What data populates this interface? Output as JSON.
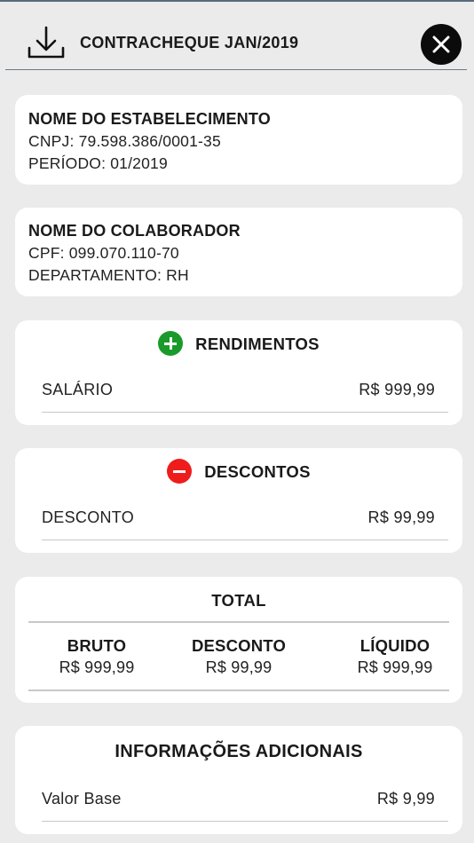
{
  "header": {
    "title": "CONTRACHEQUE JAN/2019",
    "download_icon": "download-icon",
    "close_icon": "close-icon"
  },
  "establishment": {
    "name": "NOME DO ESTABELECIMENTO",
    "cnpj": "CNPJ: 79.598.386/0001-35",
    "period": "PERÍODO: 01/2019"
  },
  "employee": {
    "name": "NOME DO COLABORADOR",
    "cpf": "CPF: 099.070.110-70",
    "department": "DEPARTAMENTO: RH"
  },
  "earnings": {
    "title": "RENDIMENTOS",
    "icon": "plus-circle-icon",
    "icon_color": "#1a9a2a",
    "items": [
      {
        "label": "SALÁRIO",
        "value": "R$ 999,99"
      }
    ]
  },
  "deductions": {
    "title": "DESCONTOS",
    "icon": "minus-circle-icon",
    "icon_color": "#ef1c1c",
    "items": [
      {
        "label": "DESCONTO",
        "value": "R$ 99,99"
      }
    ]
  },
  "total": {
    "title": "TOTAL",
    "columns": [
      {
        "label": "BRUTO",
        "value": "R$ 999,99"
      },
      {
        "label": "DESCONTO",
        "value": "R$ 99,99"
      },
      {
        "label": "LÍQUIDO",
        "value": "R$ 999,99"
      }
    ]
  },
  "additional": {
    "title": "INFORMAÇÕES ADICIONAIS",
    "items": [
      {
        "label": "Valor Base",
        "value": "R$ 9,99"
      }
    ]
  }
}
